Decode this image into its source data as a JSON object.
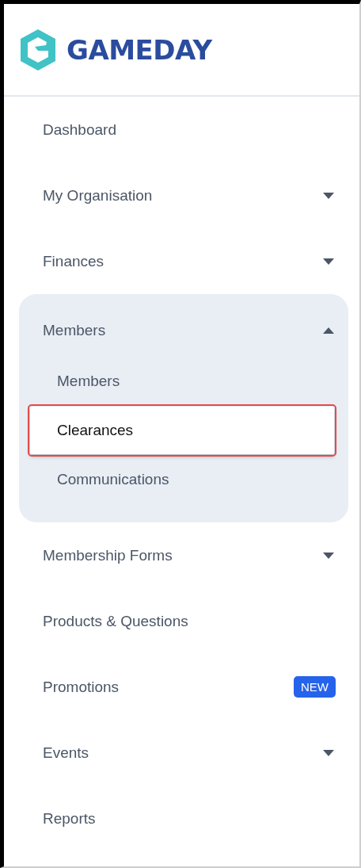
{
  "logo": {
    "text": "GAMEDAY"
  },
  "nav": [
    {
      "kind": "link",
      "label": "Dashboard"
    },
    {
      "kind": "dropdown",
      "label": "My Organisation",
      "expanded": false
    },
    {
      "kind": "dropdown",
      "label": "Finances",
      "expanded": false
    },
    {
      "kind": "dropdown",
      "label": "Members",
      "expanded": true,
      "children": [
        {
          "label": "Members",
          "selected": false,
          "highlighted": false
        },
        {
          "label": "Clearances",
          "selected": true,
          "highlighted": true
        },
        {
          "label": "Communications",
          "selected": false,
          "highlighted": false
        }
      ]
    },
    {
      "kind": "dropdown",
      "label": "Membership Forms",
      "expanded": false
    },
    {
      "kind": "link",
      "label": "Products & Questions"
    },
    {
      "kind": "link",
      "label": "Promotions",
      "badge": "NEW"
    },
    {
      "kind": "dropdown",
      "label": "Events",
      "expanded": false
    },
    {
      "kind": "link",
      "label": "Reports"
    }
  ]
}
